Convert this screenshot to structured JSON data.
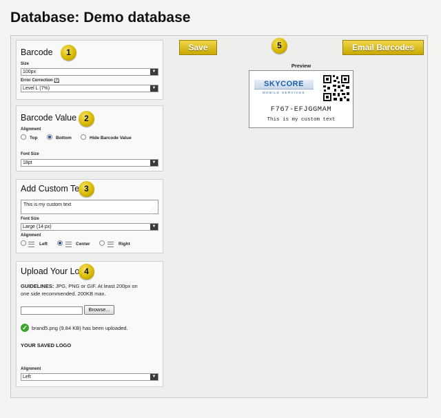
{
  "page": {
    "title": "Database: Demo database"
  },
  "steps": [
    "1",
    "2",
    "3",
    "4",
    "5"
  ],
  "barcode": {
    "title": "Barcode",
    "size_label": "Size",
    "size_value": "100px",
    "error_label": "Error Correction",
    "error_help": "(?)",
    "error_value": "Level L (7%)"
  },
  "barcode_value": {
    "title": "Barcode Value",
    "alignment_label": "Alignment",
    "options": [
      "Top",
      "Bottom",
      "Hide Barcode Value"
    ],
    "selected": "Bottom",
    "font_size_label": "Font Size",
    "font_size_value": "18pt"
  },
  "custom_text": {
    "title": "Add Custom Text",
    "text_value": "This is my custom text",
    "font_size_label": "Font Size",
    "font_size_value": "Large (14 px)",
    "alignment_label": "Alignment",
    "options": [
      "Left",
      "Center",
      "Right"
    ],
    "selected": "Center"
  },
  "logo": {
    "title": "Upload Your Logo",
    "guidelines_label": "GUIDELINES:",
    "guidelines_line1": "JPG, PNG or GIF. At least 200px on",
    "guidelines_line2": "one side recommended. 200KB max.",
    "browse_label": "Browse...",
    "upload_status": "brand5.png (9.84 KB) has been uploaded.",
    "saved_logo_label": "YOUR SAVED LOGO",
    "alignment_label": "Alignment",
    "alignment_value": "Left"
  },
  "toolbar": {
    "save_label": "Save",
    "email_label": "Email Barcodes"
  },
  "preview": {
    "label": "Preview",
    "logo_text": "SKYCORE",
    "logo_subtext": "MOBILE SERVICES",
    "barcode_value": "F767-EFJGGMAM",
    "custom_text": "This is my custom text"
  },
  "colors": {
    "gold": "#d8b800",
    "logo_blue": "#1c5fa8",
    "radio_selected": "#1c4ea0"
  },
  "icons": [
    "check-icon",
    "dropdown-arrow-icon",
    "align-left-icon",
    "align-center-icon",
    "align-right-icon",
    "qr-code-icon",
    "resize-handle-icon"
  ]
}
